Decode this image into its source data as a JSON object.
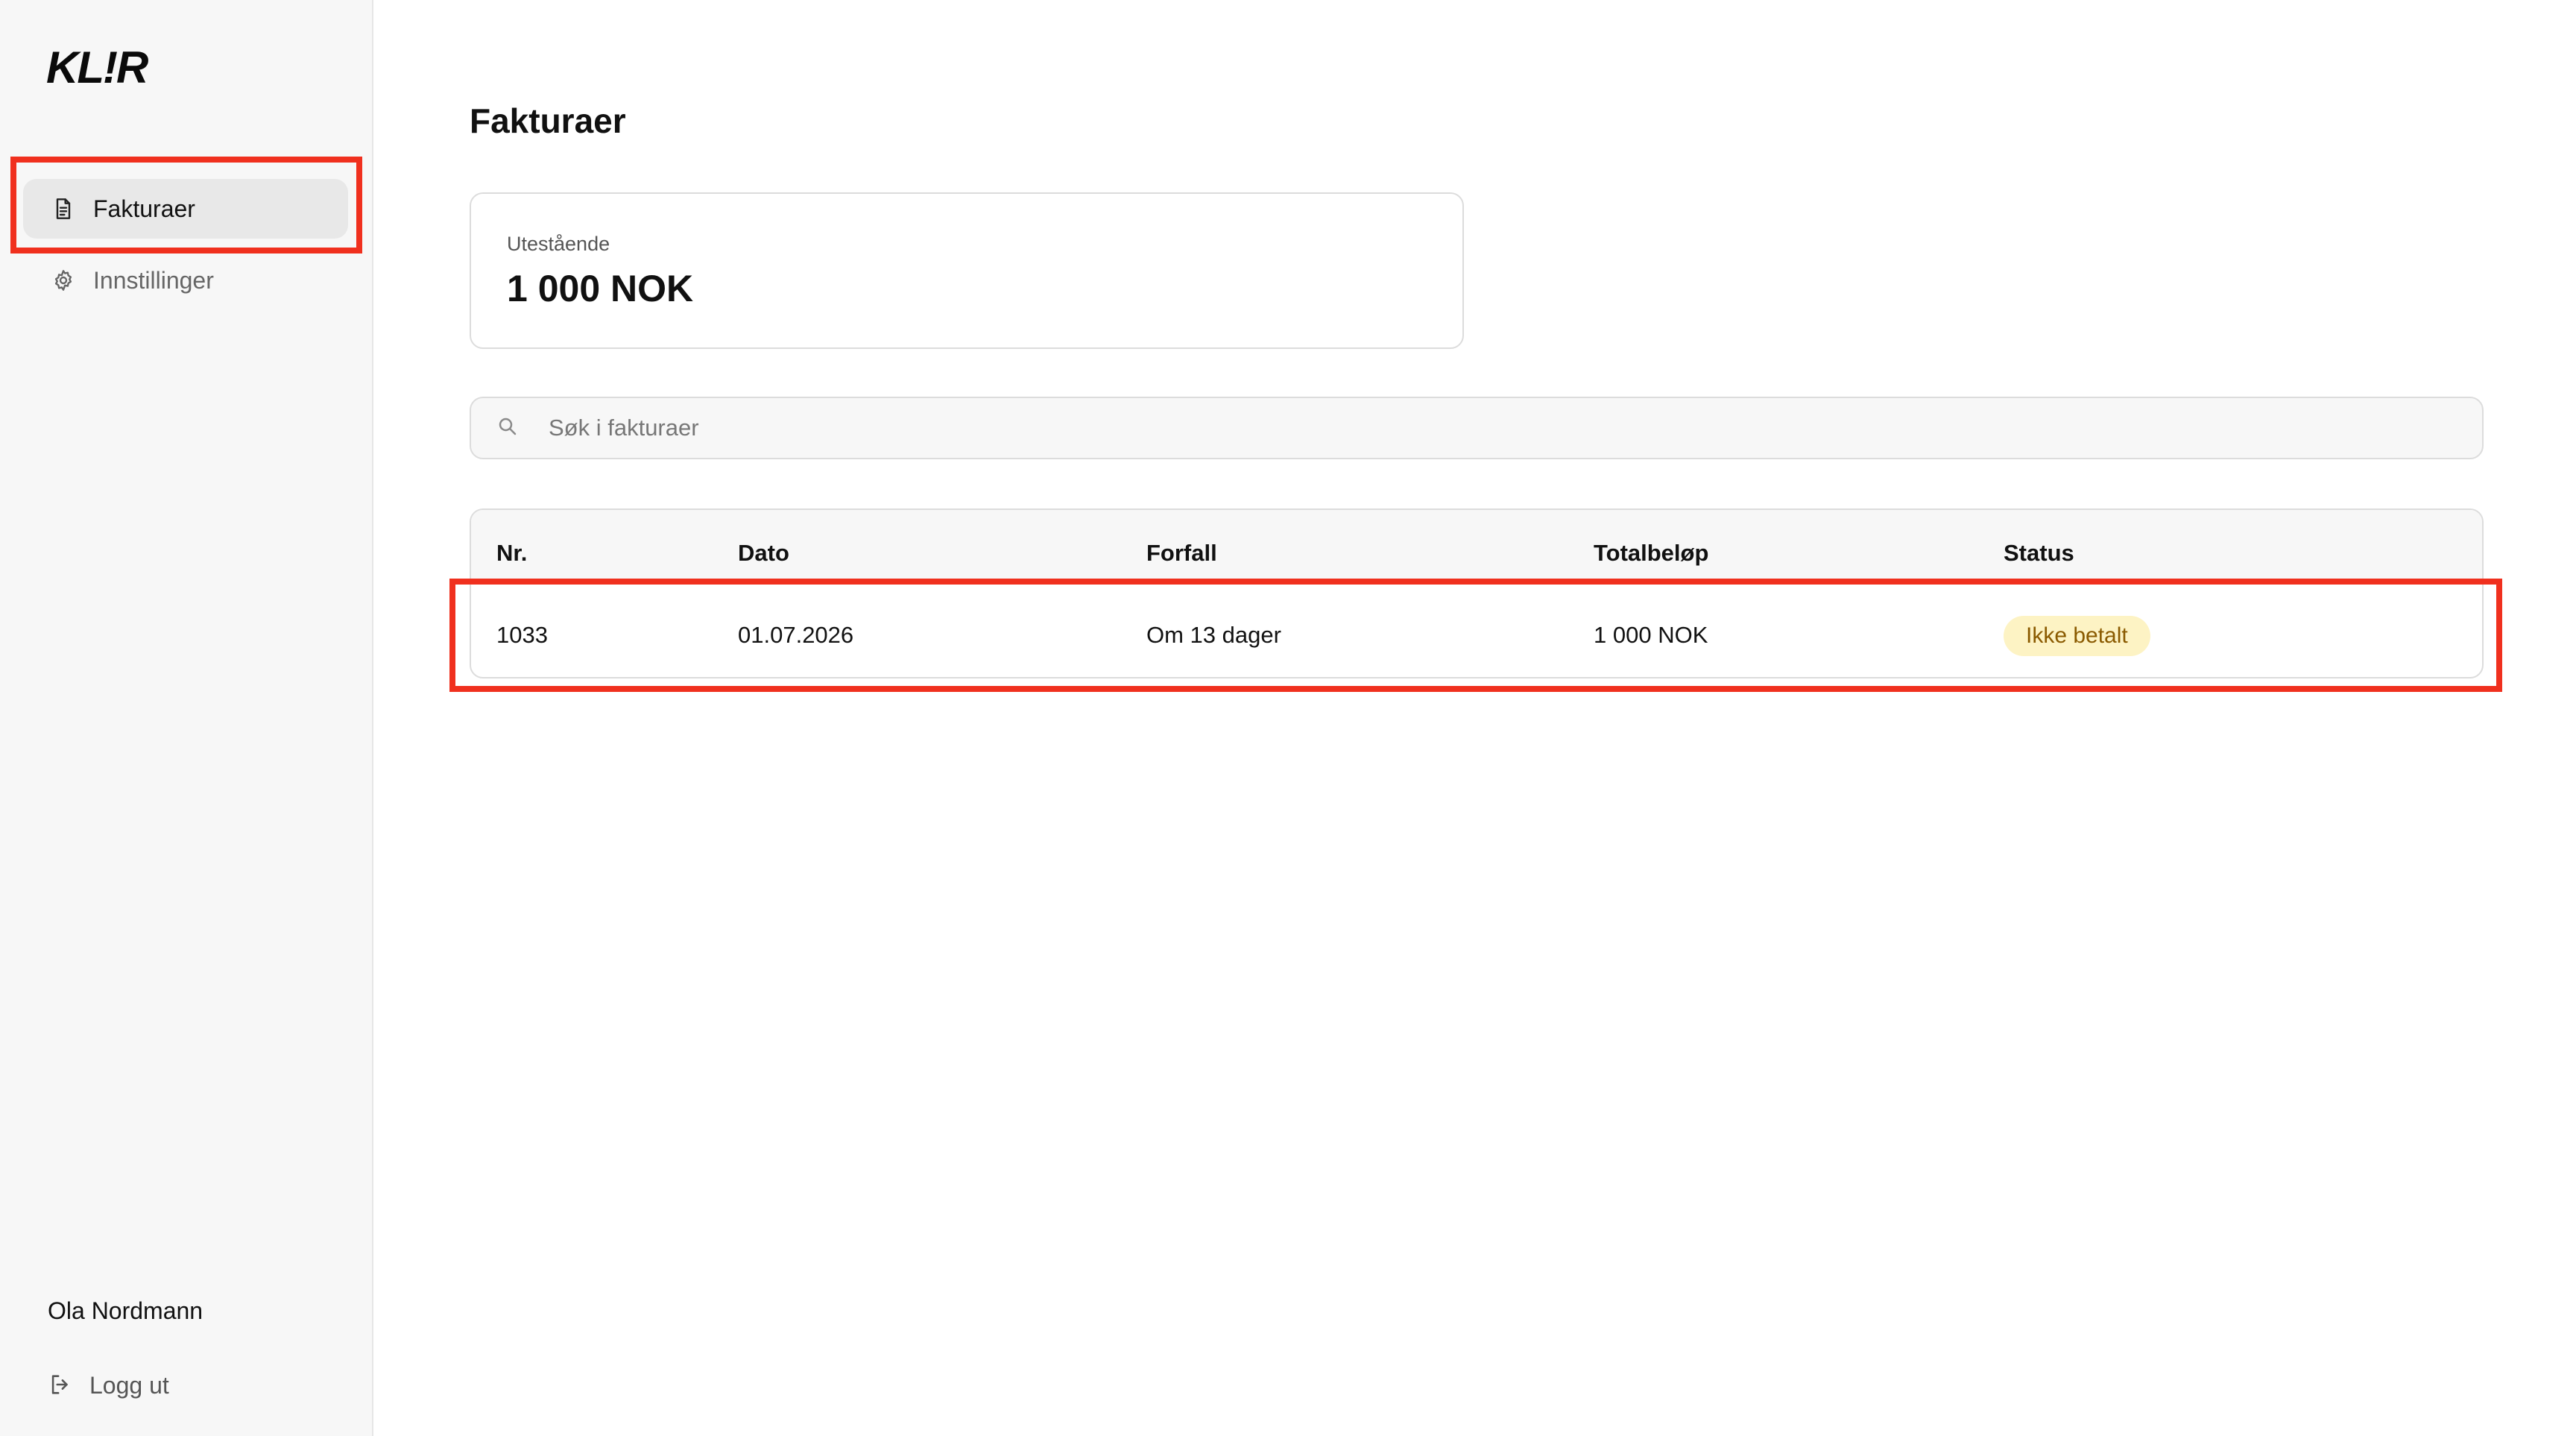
{
  "sidebar": {
    "logo": "KL!R",
    "nav": [
      {
        "label": "Fakturaer",
        "icon": "document-icon",
        "active": true
      },
      {
        "label": "Innstillinger",
        "icon": "gear-icon",
        "active": false
      }
    ],
    "user_name": "Ola Nordmann",
    "logout_label": "Logg ut",
    "logout_icon": "logout-icon"
  },
  "main": {
    "title": "Fakturaer",
    "summary": {
      "label": "Utestående",
      "value": "1 000 NOK"
    },
    "search": {
      "placeholder": "Søk i fakturaer",
      "value": "",
      "icon": "search-icon"
    },
    "table": {
      "headers": [
        "Nr.",
        "Dato",
        "Forfall",
        "Totalbeløp",
        "Status"
      ],
      "rows": [
        {
          "nr": "1033",
          "dato": "01.07.2026",
          "forfall": "Om 13 dager",
          "total": "1 000 NOK",
          "status": "Ikke betalt"
        }
      ]
    }
  },
  "colors": {
    "accent_highlight": "#f0301e",
    "status_unpaid_bg": "#fdf3c4",
    "status_unpaid_text": "#8a5a00",
    "sidebar_bg": "#f7f7f7"
  }
}
